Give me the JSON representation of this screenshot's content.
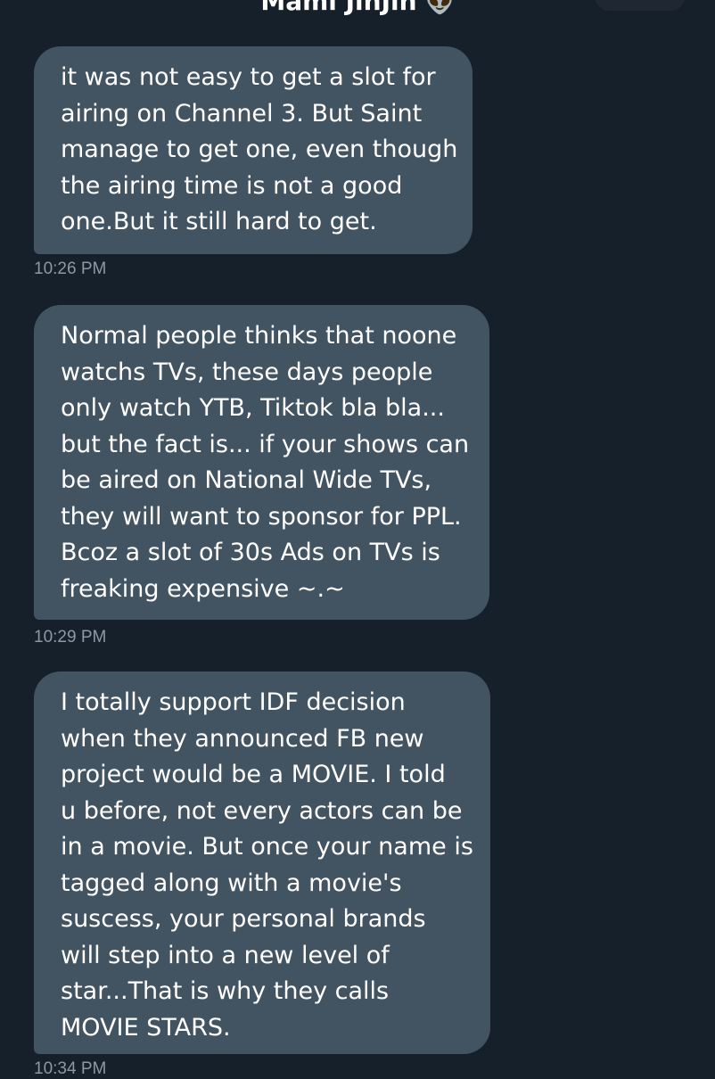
{
  "header": {
    "title": "Mami JinJin",
    "title_emoji": "👽"
  },
  "messages": [
    {
      "lines": [
        "it was not easy to get a slot for",
        "airing on Channel 3. But Saint",
        "manage to get one, even though",
        "the airing time is not a good",
        "one.But it still hard to get."
      ],
      "time": "10:26 PM"
    },
    {
      "lines": [
        "Normal people thinks that noone",
        "watchs TVs, these days people",
        "only watch YTB, Tiktok bla bla...",
        "but the fact is... if your shows can",
        "be aired on National Wide TVs,",
        "they will want to sponsor for PPL.",
        "Bcoz a slot of 30s Ads on TVs is",
        "freaking expensive ~.~"
      ],
      "time": "10:29 PM"
    },
    {
      "lines": [
        "I totally support IDF decision",
        "when they announced FB new",
        "project would be a MOVIE. I told",
        "u before, not every actors can be",
        "in a movie. But once your name is",
        "tagged along with a movie's",
        "suscess, your personal brands",
        "will step into a new level of",
        "star...That is why they calls",
        "MOVIE STARS."
      ],
      "time": "10:34 PM"
    }
  ],
  "colors": {
    "background": "#15202b",
    "bubble": "#425362",
    "text": "#ffffff",
    "timestamp": "#8b98a5"
  }
}
